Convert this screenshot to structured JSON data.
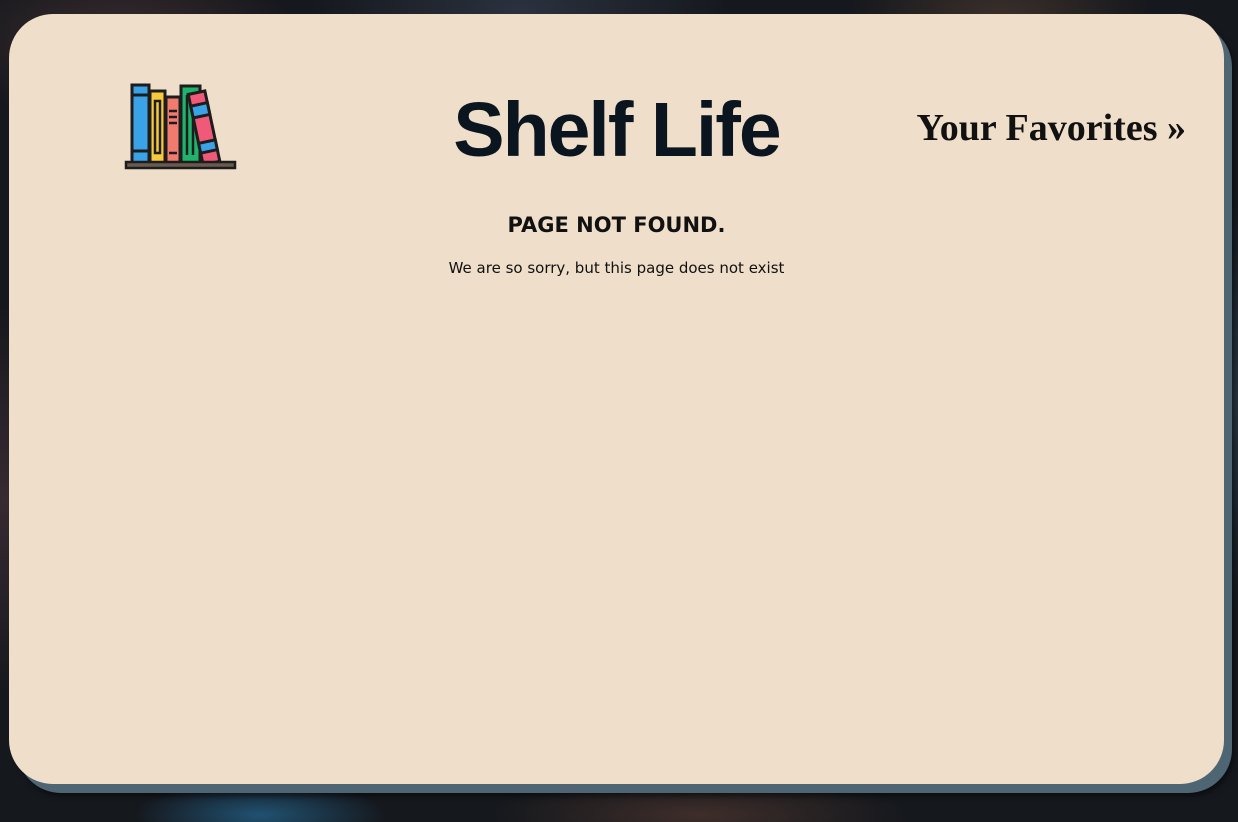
{
  "header": {
    "logo_icon": "bookshelf-icon",
    "site_title": "Shelf Life",
    "favorites_link": "Your Favorites »"
  },
  "main": {
    "heading": "PAGE NOT FOUND.",
    "message": "We are so sorry, but this page does not exist"
  },
  "colors": {
    "card_background": "#efdfca",
    "card_shadow": "#4e6674",
    "title_text": "#0b1520"
  }
}
